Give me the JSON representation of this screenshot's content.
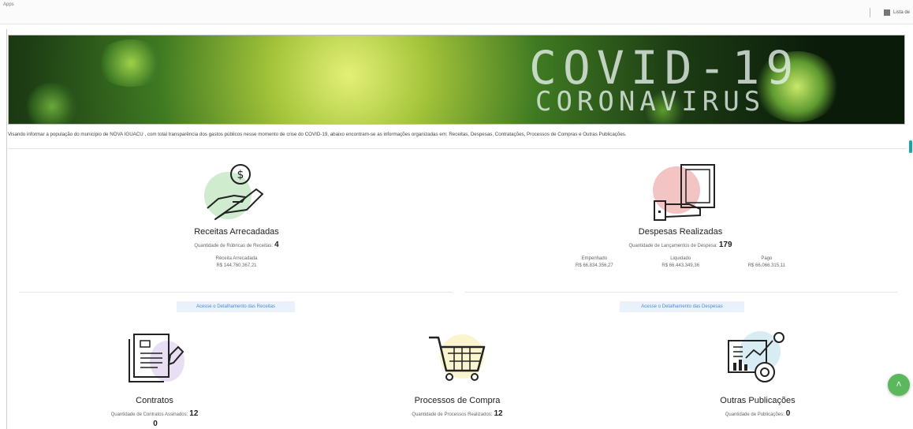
{
  "browser": {
    "apps_label": "Apps",
    "reading_list_label": "Lista de"
  },
  "banner": {
    "line1": "COVID-19",
    "line2": "CORONAVIRUS"
  },
  "intro_text": "Visando informar a população do município de NOVA IGUACU , com total transparência dos gastos públicos nesse momento de crise do COVID-19, abaixo encontram-se as informações organizadas em: Receitas, Despesas, Contratações, Processos de Compras e Outras Publicações.",
  "receitas": {
    "title": "Receitas Arrecadadas",
    "qty_label": "Quantidade de Rúbricas de Receitas:",
    "qty_value": "4",
    "arrecadada_label": "Receita Arrecadada",
    "arrecadada_value": "R$ 144.760.367,21",
    "link": "Acesse o Detalhamento das Receitas"
  },
  "despesas": {
    "title": "Despesas Realizadas",
    "qty_label": "Quantidade de Lançamentos de Despesa:",
    "qty_value": "179",
    "empenhado_label": "Empenhado",
    "empenhado_value": "R$ 66.834.356,27",
    "liquidado_label": "Liquidado",
    "liquidado_value": "R$ 66.443.349,36",
    "pago_label": "Pago",
    "pago_value": "R$ 66.066.315,11",
    "link": "Acesse o Detalhamento das Despesas"
  },
  "contratos": {
    "title": "Contratos",
    "qty_label": "Quantidade de Contratos Assinados:",
    "qty_value": "12",
    "sub_value": "0"
  },
  "processos": {
    "title": "Processos de Compra",
    "qty_label": "Quantidade de Processos Realizados:",
    "qty_value": "12"
  },
  "outras": {
    "title": "Outras Publicações",
    "qty_label": "Quantidade de Publicações:",
    "qty_value": "0"
  },
  "fab_glyph": "˄",
  "colors": {
    "accent_link": "#4a8bd8",
    "fab": "#5cb85c",
    "receitas_bubble": "#cfeccf",
    "despesas_bubble": "#f2c4c4"
  }
}
